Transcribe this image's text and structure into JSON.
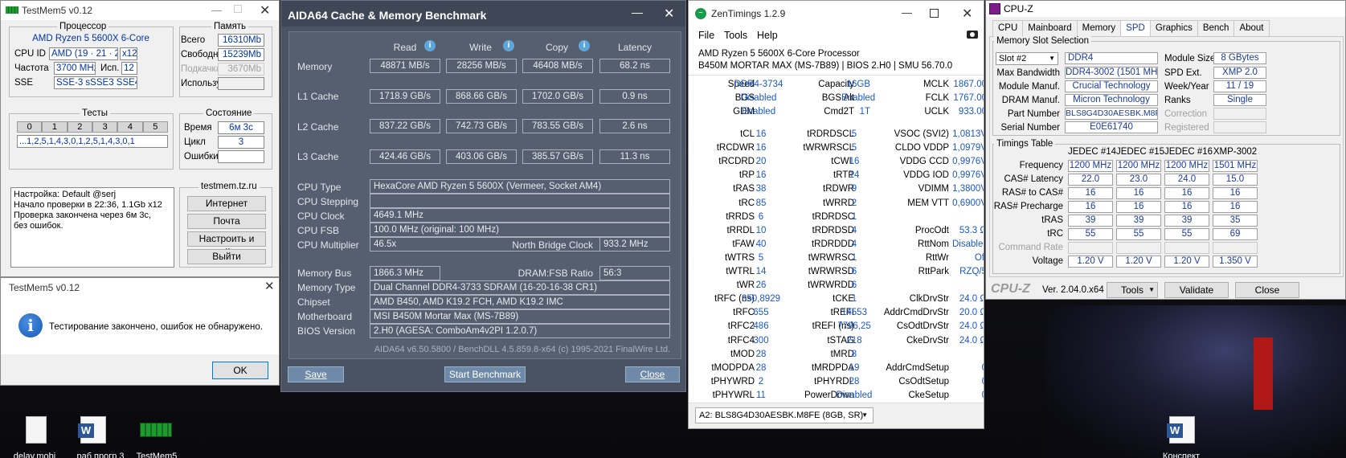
{
  "desktop": {
    "icons": [
      "delay.mobi",
      "раб прогр 3",
      "TestMem5",
      "Конспект"
    ]
  },
  "tm5": {
    "title": "TestMem5 v0.12",
    "processor": {
      "label": "Процессор",
      "name": "AMD Ryzen 5 5600X 6-Core",
      "cpuid_label": "CPU ID",
      "cpuid": "AMD  (19 · 21 · 2)",
      "threads": "x12",
      "freq_label": "Частота",
      "freq": "3700 MHz",
      "used_label": "Исп.",
      "used": "12",
      "sse_label": "SSE",
      "sse": "SSE-3 sSSE3 SSE4.1"
    },
    "memory": {
      "label": "Память",
      "total_label": "Всего",
      "total": "16310Mb",
      "free_label": "Свободно",
      "free": "15239Mb",
      "swap_label": "Подкачка",
      "swap": "3670Mb",
      "usedm_label": "Используется",
      "usedm": ""
    },
    "tests": {
      "label": "Тесты",
      "cols": [
        "0",
        "1",
        "2",
        "3",
        "4",
        "5"
      ],
      "sequence": "...1,2,5,1,4,3,0,1,2,5,1,4,3,0,1"
    },
    "state": {
      "label": "Состояние",
      "time_label": "Время",
      "time": "6м 3с",
      "cycle_label": "Цикл",
      "cycle": "3",
      "errors_label": "Ошибки",
      "errors": ""
    },
    "log": [
      "Настройка: Default @serj",
      "Начало проверки в 22:36, 1.1Gb x12",
      "Проверка закончена через 6м 3с,",
      "без ошибок."
    ],
    "site": {
      "label": "testmem.tz.ru",
      "buttons": [
        "Интернет",
        "Почта",
        "Настроить и выйти",
        "Выйти"
      ]
    }
  },
  "dialog": {
    "title": "TestMem5 v0.12",
    "message": "Тестирование закончено, ошибок не обнаружено.",
    "ok": "OK"
  },
  "aida": {
    "title": "AIDA64 Cache & Memory Benchmark",
    "headers": [
      "Read",
      "Write",
      "Copy",
      "Latency"
    ],
    "rows": [
      {
        "label": "Memory",
        "read": "48871 MB/s",
        "write": "28256 MB/s",
        "copy": "46408 MB/s",
        "latency": "68.2 ns"
      },
      {
        "label": "L1 Cache",
        "read": "1718.9 GB/s",
        "write": "868.66 GB/s",
        "copy": "1702.0 GB/s",
        "latency": "0.9 ns"
      },
      {
        "label": "L2 Cache",
        "read": "837.22 GB/s",
        "write": "742.73 GB/s",
        "copy": "783.55 GB/s",
        "latency": "2.6 ns"
      },
      {
        "label": "L3 Cache",
        "read": "424.46 GB/s",
        "write": "403.06 GB/s",
        "copy": "385.57 GB/s",
        "latency": "11.3 ns"
      }
    ],
    "cpu_type_label": "CPU Type",
    "cpu_type": "HexaCore AMD Ryzen 5 5600X  (Vermeer, Socket AM4)",
    "cpu_stepping_label": "CPU Stepping",
    "cpu_stepping": "",
    "cpu_clock_label": "CPU Clock",
    "cpu_clock": "4649.1 MHz",
    "cpu_fsb_label": "CPU FSB",
    "cpu_fsb": "100.0 MHz  (original: 100 MHz)",
    "cpu_mult_label": "CPU Multiplier",
    "cpu_mult": "46.5x",
    "nb_label": "North Bridge Clock",
    "nb": "933.2 MHz",
    "membus_label": "Memory Bus",
    "membus": "1866.3 MHz",
    "dram_label": "DRAM:FSB Ratio",
    "dram": "56:3",
    "memtype_label": "Memory Type",
    "memtype": "Dual Channel DDR4-3733 SDRAM  (16-20-16-38 CR1)",
    "chipset_label": "Chipset",
    "chipset": "AMD B450, AMD K19.2 FCH, AMD K19.2 IMC",
    "mobo_label": "Motherboard",
    "mobo": "MSI B450M Mortar Max (MS-7B89)",
    "bios_label": "BIOS Version",
    "bios": "2.H0  (AGESA: ComboAm4v2PI 1.2.0.7)",
    "footer": "AIDA64 v6.50.5800 / BenchDLL 4.5.859.8-x64  (c) 1995-2021 FinalWire Ltd.",
    "save": "Save",
    "start": "Start Benchmark",
    "close": "Close"
  },
  "zen": {
    "title": "ZenTimings 1.2.9",
    "menu": [
      "File",
      "Tools",
      "Help"
    ],
    "cpu": "AMD Ryzen 5 5600X 6-Core Processor",
    "board": "B450M MORTAR MAX (MS-7B89) | BIOS 2.H0 | SMU 56.70.0",
    "top": [
      {
        "a": "Speed",
        "av": "DDR4-3734",
        "b": "Capacity",
        "bv": "16GB",
        "c": "MCLK",
        "cv": "1867.00"
      },
      {
        "a": "BGS",
        "av": "Disabled",
        "b": "BGS Alt",
        "bv": "Enabled",
        "c": "FCLK",
        "cv": "1767.00"
      },
      {
        "a": "GDM",
        "av": "Enabled",
        "b": "Cmd2T",
        "bv": "1T",
        "c": "UCLK",
        "cv": "933.00"
      }
    ],
    "rows": [
      {
        "a": "tCL",
        "av": "16",
        "b": "tRDRDSCL",
        "bv": "5",
        "c": "VSOC (SVI2)",
        "cv": "1,0813V"
      },
      {
        "a": "tRCDWR",
        "av": "16",
        "b": "tWRWRSCL",
        "bv": "5",
        "c": "CLDO VDDP",
        "cv": "1,0979V"
      },
      {
        "a": "tRCDRD",
        "av": "20",
        "b": "tCWL",
        "bv": "16",
        "c": "VDDG CCD",
        "cv": "0,9976V"
      },
      {
        "a": "tRP",
        "av": "16",
        "b": "tRTP",
        "bv": "14",
        "c": "VDDG IOD",
        "cv": "0,9976V"
      },
      {
        "a": "tRAS",
        "av": "38",
        "b": "tRDWR",
        "bv": "9",
        "c": "VDIMM",
        "cv": "1,3800V"
      },
      {
        "a": "tRC",
        "av": "85",
        "b": "tWRRD",
        "bv": "2",
        "c": "MEM VTT",
        "cv": "0,6900V"
      },
      {
        "a": "tRRDS",
        "av": "6",
        "b": "tRDRDSC",
        "bv": "1",
        "c": "",
        "cv": ""
      },
      {
        "a": "tRRDL",
        "av": "10",
        "b": "tRDRDSD",
        "bv": "4",
        "c": "ProcOdt",
        "cv": "53.3 Ω"
      },
      {
        "a": "tFAW",
        "av": "40",
        "b": "tRDRDDD",
        "bv": "4",
        "c": "RttNom",
        "cv": "Disabled"
      },
      {
        "a": "tWTRS",
        "av": "5",
        "b": "tWRWRSC",
        "bv": "1",
        "c": "RttWr",
        "cv": "Off"
      },
      {
        "a": "tWTRL",
        "av": "14",
        "b": "tWRWRSD",
        "bv": "6",
        "c": "RttPark",
        "cv": "RZQ/5"
      },
      {
        "a": "tWR",
        "av": "26",
        "b": "tWRWRDD",
        "bv": "6",
        "c": "",
        "cv": ""
      },
      {
        "a": "tRFC (ns)",
        "av": "350,8929",
        "b": "tCKE",
        "bv": "1",
        "c": "ClkDrvStr",
        "cv": "24.0 Ω"
      },
      {
        "a": "tRFC",
        "av": "655",
        "b": "tREFI",
        "bv": "14553",
        "c": "AddrCmdDrvStr",
        "cv": "20.0 Ω"
      },
      {
        "a": "tRFC2",
        "av": "486",
        "b": "tREFI (ns)",
        "bv": "7796,25",
        "c": "CsOdtDrvStr",
        "cv": "24.0 Ω"
      },
      {
        "a": "tRFC4",
        "av": "300",
        "b": "tSTAG",
        "bv": "218",
        "c": "CkeDrvStr",
        "cv": "24.0 Ω"
      },
      {
        "a": "tMOD",
        "av": "28",
        "b": "tMRD",
        "bv": "8",
        "c": "",
        "cv": ""
      },
      {
        "a": "tMODPDA",
        "av": "28",
        "b": "tMRDPDA",
        "bv": "19",
        "c": "AddrCmdSetup",
        "cv": "0"
      },
      {
        "a": "tPHYWRD",
        "av": "2",
        "b": "tPHYRDL",
        "bv": "28",
        "c": "CsOdtSetup",
        "cv": "0"
      },
      {
        "a": "tPHYWRL",
        "av": "11",
        "b": "PowerDown",
        "bv": "Disabled",
        "c": "CkeSetup",
        "cv": "0"
      }
    ],
    "dimm": "A2: BLS8G4D30AESBK.M8FE (8GB, SR)"
  },
  "cpuz": {
    "title": "CPU-Z",
    "tabs": [
      "CPU",
      "Mainboard",
      "Memory",
      "SPD",
      "Graphics",
      "Bench",
      "About"
    ],
    "slot_group": "Memory Slot Selection",
    "slot": "Slot #2",
    "type": "DDR4",
    "module_size_label": "Module Size",
    "module_size": "8 GBytes",
    "max_bw_label": "Max Bandwidth",
    "max_bw": "DDR4-3002 (1501 MHz)",
    "spd_ext_label": "SPD Ext.",
    "spd_ext": "XMP 2.0",
    "mod_manuf_label": "Module Manuf.",
    "mod_manuf": "Crucial Technology",
    "week_label": "Week/Year",
    "week": "11 / 19",
    "dram_manuf_label": "DRAM Manuf.",
    "dram_manuf": "Micron Technology",
    "ranks_label": "Ranks",
    "ranks": "Single",
    "part_label": "Part Number",
    "part": "BLS8G4D30AESBK.M8FE",
    "correction_label": "Correction",
    "serial_label": "Serial Number",
    "serial": "E0E61740",
    "registered_label": "Registered",
    "tt_group": "Timings Table",
    "tt_cols": [
      "JEDEC #14",
      "JEDEC #15",
      "JEDEC #16",
      "XMP-3002"
    ],
    "tt_rows": [
      {
        "label": "Frequency",
        "v": [
          "1200 MHz",
          "1200 MHz",
          "1200 MHz",
          "1501 MHz"
        ]
      },
      {
        "label": "CAS# Latency",
        "v": [
          "22.0",
          "23.0",
          "24.0",
          "15.0"
        ]
      },
      {
        "label": "RAS# to CAS#",
        "v": [
          "16",
          "16",
          "16",
          "16"
        ]
      },
      {
        "label": "RAS# Precharge",
        "v": [
          "16",
          "16",
          "16",
          "16"
        ]
      },
      {
        "label": "tRAS",
        "v": [
          "39",
          "39",
          "39",
          "35"
        ]
      },
      {
        "label": "tRC",
        "v": [
          "55",
          "55",
          "55",
          "69"
        ]
      },
      {
        "label": "Command Rate",
        "v": [
          "",
          "",
          "",
          ""
        ]
      },
      {
        "label": "Voltage",
        "v": [
          "1.20 V",
          "1.20 V",
          "1.20 V",
          "1.350 V"
        ]
      }
    ],
    "brand": "CPU-Z",
    "version": "Ver. 2.04.0.x64",
    "tools": "Tools",
    "validate": "Validate",
    "close": "Close"
  }
}
